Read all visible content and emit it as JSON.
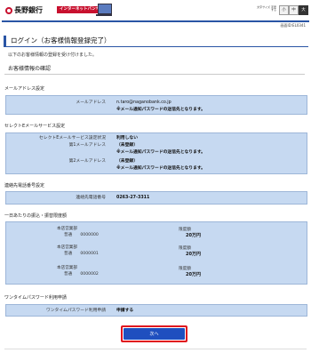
{
  "header": {
    "bank_name": "長野銀行",
    "service_badge": "インターネットバンキング",
    "service_sub": "",
    "text_size_label": "文字サイズ\n変更する",
    "size_small": "小",
    "size_medium": "中",
    "size_large": "大",
    "screen_id": "画面ID:EL0341"
  },
  "page": {
    "title": "ログイン（お客様情報登録完了）",
    "lead": "以下のお客様情報の登録を受け付けました。",
    "section_heading": "お客様情報の確認"
  },
  "email_section": {
    "label": "メールアドレス設定",
    "row_label": "メールアドレス",
    "value": "n.taro@naganobank.co.jp",
    "note": "※メール通知パスワードの送信先となります。"
  },
  "select_section": {
    "label": "セレクトEメールサービス設定",
    "status_label": "セレクトEメールサービス設定状況",
    "status_value": "利用しない",
    "addr1_label": "第1メールアドレス",
    "addr1_value": "（未登録）",
    "addr1_note": "※メール通知パスワードの送信先となります。",
    "addr2_label": "第2メールアドレス",
    "addr2_value": "（未登録）",
    "addr2_note": "※メール通知パスワードの送信先となります。"
  },
  "phone_section": {
    "label": "連絡先電話番号設定",
    "row_label": "連絡先電話番号",
    "value": "0263-27-3311"
  },
  "limit_section": {
    "label": "一日あたりの振込・振替限度額",
    "accounts": [
      {
        "branch": "本店営業部",
        "line": "普通　　0000000",
        "limit_label": "限度額",
        "limit_value": "20万円"
      },
      {
        "branch": "本店営業部",
        "line": "普通　　0000001",
        "limit_label": "限度額",
        "limit_value": "20万円"
      },
      {
        "branch": "本店営業部",
        "line": "普通　　0000002",
        "limit_label": "限度額",
        "limit_value": "20万円"
      }
    ]
  },
  "otp_section": {
    "label": "ワンタイムパスワード利用申請",
    "row_label": "ワンタイムパスワード利用申請",
    "value": "申請する"
  },
  "actions": {
    "next_label": "次へ"
  }
}
